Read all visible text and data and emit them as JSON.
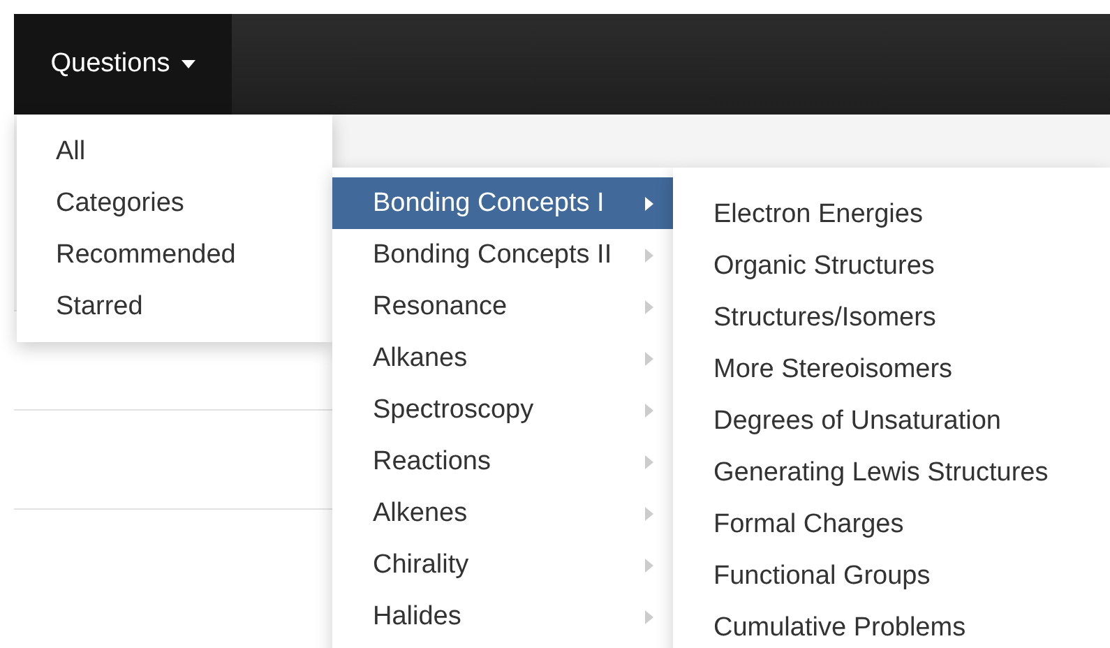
{
  "navbar": {
    "menu_button": "Questions"
  },
  "questions_menu": [
    "All",
    "Categories",
    "Recommended",
    "Starred"
  ],
  "categories_menu": [
    {
      "label": "Bonding Concepts I",
      "selected": true
    },
    {
      "label": "Bonding Concepts II",
      "selected": false
    },
    {
      "label": "Resonance",
      "selected": false
    },
    {
      "label": "Alkanes",
      "selected": false
    },
    {
      "label": "Spectroscopy",
      "selected": false
    },
    {
      "label": "Reactions",
      "selected": false
    },
    {
      "label": "Alkenes",
      "selected": false
    },
    {
      "label": "Chirality",
      "selected": false
    },
    {
      "label": "Halides",
      "selected": false
    }
  ],
  "topics_menu": [
    "Electron Energies",
    "Organic Structures",
    "Structures/Isomers",
    "More Stereoisomers",
    "Degrees of Unsaturation",
    "Generating Lewis Structures",
    "Formal Charges",
    "Functional Groups",
    "Cumulative Problems"
  ]
}
